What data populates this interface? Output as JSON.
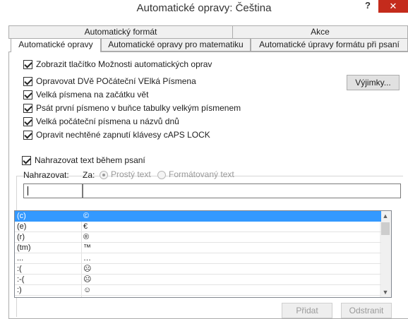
{
  "window": {
    "title": "Automatické opravy: Čeština",
    "help": "?",
    "close": "✕"
  },
  "tabs": {
    "back": [
      "Automatický formát",
      "Akce"
    ],
    "front": [
      "Automatické opravy",
      "Automatické opravy pro matematiku",
      "Automatické úpravy formátu při psaní"
    ],
    "active": "Automatické opravy"
  },
  "options": {
    "show_buttons": "Zobrazit tlačítko Možnosti automatických oprav",
    "two_initial_caps": "Opravovat DVě POčáteční VElká Písmena",
    "first_letter_sentence": "Velká písmena na začátku vět",
    "first_letter_table": "Psát první písmeno v buňce tabulky velkým písmenem",
    "day_names": "Velká počáteční písmena u názvů dnů",
    "caps_lock": "Opravit nechtěné zapnutí klávesy cAPS LOCK",
    "exceptions_button": "Výjimky..."
  },
  "replace": {
    "checkbox": "Nahrazovat text během psaní",
    "replace_label": "Nahrazovat:",
    "with_label": "Za:",
    "plain_text": "Prostý text",
    "formatted_text": "Formátovaný text",
    "replace_value": "",
    "with_value": ""
  },
  "entries": [
    {
      "from": "(c)",
      "to": "©"
    },
    {
      "from": "(e)",
      "to": "€"
    },
    {
      "from": "(r)",
      "to": "®"
    },
    {
      "from": "(tm)",
      "to": "™"
    },
    {
      "from": "...",
      "to": "…"
    },
    {
      "from": ":(",
      "to": "☹"
    },
    {
      "from": ":-(",
      "to": "☹"
    },
    {
      "from": ":)",
      "to": "☺"
    }
  ],
  "buttons": {
    "add": "Přidat",
    "delete": "Odstranit"
  },
  "colors": {
    "selection": "#3399ff",
    "close_button": "#c42b1c"
  }
}
